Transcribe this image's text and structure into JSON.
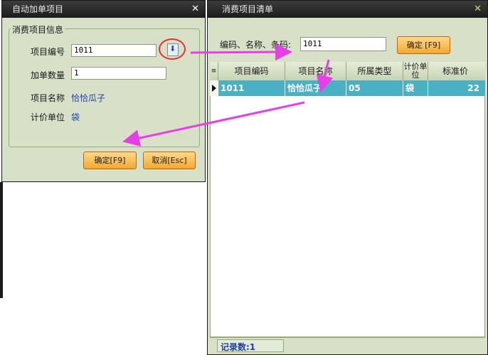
{
  "left_dialog": {
    "title": "自动加单项目",
    "group_title": "消费项目信息",
    "code_label": "项目编号",
    "code_value": "1011",
    "qty_label": "加单数量",
    "qty_value": "1",
    "name_label": "项目名称",
    "name_value": "恰恰瓜子",
    "unit_label": "计价单位",
    "unit_value": "袋",
    "ok_label": "确定[F9]",
    "cancel_label": "取消[Esc]"
  },
  "right_dialog": {
    "title": "消费项目清单",
    "search_label": "编码、名称、条码:",
    "search_value": "1011",
    "ok_label": "确定 [F9]",
    "columns": [
      "项目编码",
      "项目名称",
      "所属类型",
      "计价单位",
      "标准价"
    ],
    "rows": [
      {
        "code": "1011",
        "name": "恰恰瓜子",
        "type": "05",
        "unit": "袋",
        "price": "22"
      }
    ],
    "record_count_label": "记录数:1"
  },
  "colors": {
    "selected_row": "#4ab0c4",
    "arrow": "#e83ee8",
    "highlight_circle": "#e83030"
  }
}
